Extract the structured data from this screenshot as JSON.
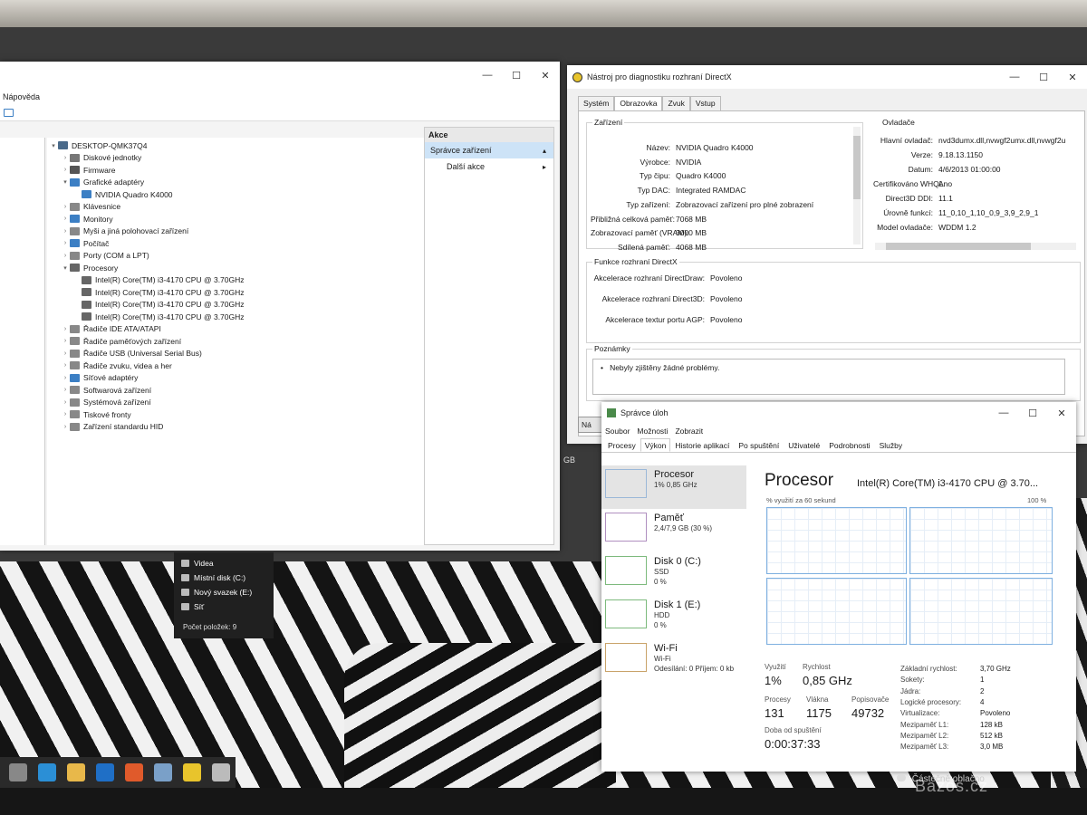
{
  "device_manager": {
    "menu_label": "Nápověda",
    "tree": [
      {
        "label": "DESKTOP-QMK37Q4",
        "depth": 0,
        "arrow": "▾",
        "color": "#4a6a8a"
      },
      {
        "label": "Diskové jednotky",
        "depth": 1,
        "arrow": "›",
        "color": "#777777"
      },
      {
        "label": "Firmware",
        "depth": 1,
        "arrow": "›",
        "color": "#555555"
      },
      {
        "label": "Grafické adaptéry",
        "depth": 1,
        "arrow": "▾",
        "color": "#3c7fc4"
      },
      {
        "label": "NVIDIA Quadro K4000",
        "depth": 2,
        "arrow": "",
        "color": "#3c7fc4"
      },
      {
        "label": "Klávesnice",
        "depth": 1,
        "arrow": "›",
        "color": "#888888"
      },
      {
        "label": "Monitory",
        "depth": 1,
        "arrow": "›",
        "color": "#3c7fc4"
      },
      {
        "label": "Myši a jiná polohovací zařízení",
        "depth": 1,
        "arrow": "›",
        "color": "#888888"
      },
      {
        "label": "Počítač",
        "depth": 1,
        "arrow": "›",
        "color": "#3c7fc4"
      },
      {
        "label": "Porty (COM a LPT)",
        "depth": 1,
        "arrow": "›",
        "color": "#888888"
      },
      {
        "label": "Procesory",
        "depth": 1,
        "arrow": "▾",
        "color": "#666666"
      },
      {
        "label": "Intel(R) Core(TM) i3-4170 CPU @ 3.70GHz",
        "depth": 2,
        "arrow": "",
        "color": "#666666"
      },
      {
        "label": "Intel(R) Core(TM) i3-4170 CPU @ 3.70GHz",
        "depth": 2,
        "arrow": "",
        "color": "#666666"
      },
      {
        "label": "Intel(R) Core(TM) i3-4170 CPU @ 3.70GHz",
        "depth": 2,
        "arrow": "",
        "color": "#666666"
      },
      {
        "label": "Intel(R) Core(TM) i3-4170 CPU @ 3.70GHz",
        "depth": 2,
        "arrow": "",
        "color": "#666666"
      },
      {
        "label": "Řadiče IDE ATA/ATAPI",
        "depth": 1,
        "arrow": "›",
        "color": "#888888"
      },
      {
        "label": "Řadiče paměťových zařízení",
        "depth": 1,
        "arrow": "›",
        "color": "#888888"
      },
      {
        "label": "Řadiče USB (Universal Serial Bus)",
        "depth": 1,
        "arrow": "›",
        "color": "#888888"
      },
      {
        "label": "Řadiče zvuku, videa a her",
        "depth": 1,
        "arrow": "›",
        "color": "#888888"
      },
      {
        "label": "Síťové adaptéry",
        "depth": 1,
        "arrow": "›",
        "color": "#3c7fc4"
      },
      {
        "label": "Softwarová zařízení",
        "depth": 1,
        "arrow": "›",
        "color": "#888888"
      },
      {
        "label": "Systémová zařízení",
        "depth": 1,
        "arrow": "›",
        "color": "#888888"
      },
      {
        "label": "Tiskové fronty",
        "depth": 1,
        "arrow": "›",
        "color": "#888888"
      },
      {
        "label": "Zařízení standardu HID",
        "depth": 1,
        "arrow": "›",
        "color": "#888888"
      }
    ],
    "actions_header": "Akce",
    "actions": [
      {
        "label": "Správce zařízení",
        "selected": true,
        "chevron": "▴"
      },
      {
        "label": "Další akce",
        "selected": false,
        "chevron": "▸"
      }
    ]
  },
  "dxdiag": {
    "title": "Nástroj pro diagnostiku rozhraní DirectX",
    "tabs": [
      "Systém",
      "Obrazovka",
      "Zvuk",
      "Vstup"
    ],
    "active_tab": 1,
    "device_group": "Zařízení",
    "device_rows": [
      {
        "k": "Název:",
        "v": "NVIDIA Quadro K4000"
      },
      {
        "k": "Výrobce:",
        "v": "NVIDIA"
      },
      {
        "k": "Typ čipu:",
        "v": "Quadro K4000"
      },
      {
        "k": "Typ DAC:",
        "v": "Integrated RAMDAC"
      },
      {
        "k": "Typ zařízení:",
        "v": "Zobrazovací zařízení pro plné zobrazení"
      },
      {
        "k": "Přibližná celková paměť:",
        "v": "7068 MB"
      },
      {
        "k": "Zobrazovací paměť (VRAM):",
        "v": "3000 MB"
      },
      {
        "k": "Sdílená paměť:",
        "v": "4068 MB"
      }
    ],
    "driver_group": "Ovladače",
    "driver_rows": [
      {
        "k": "Hlavní ovladač:",
        "v": "nvd3dumx.dll,nvwgf2umx.dll,nvwgf2u"
      },
      {
        "k": "Verze:",
        "v": "9.18.13.1150"
      },
      {
        "k": "Datum:",
        "v": "4/6/2013 01:00:00"
      },
      {
        "k": "Certifikováno WHQL:",
        "v": "Ano"
      },
      {
        "k": "Direct3D DDI:",
        "v": "11.1"
      },
      {
        "k": "Úrovně funkcí:",
        "v": "11_0,10_1,10_0,9_3,9_2,9_1"
      },
      {
        "k": "Model ovladače:",
        "v": "WDDM 1.2"
      }
    ],
    "features_group": "Funkce rozhraní DirectX",
    "features": [
      {
        "k": "Akcelerace rozhraní DirectDraw:",
        "v": "Povoleno"
      },
      {
        "k": "Akcelerace rozhraní Direct3D:",
        "v": "Povoleno"
      },
      {
        "k": "Akcelerace textur portu AGP:",
        "v": "Povoleno"
      }
    ],
    "notes_group": "Poznámky",
    "notes": "Nebyly zjištěny žádné problémy.",
    "bottom_btn_stub": "Ná",
    "gb_stub": "GB"
  },
  "explorer": {
    "items": [
      "Videa",
      "Místní disk (C:)",
      "Nový svazek (E:)",
      "Síť"
    ],
    "status": "Počet položek: 9"
  },
  "task_manager": {
    "title": "Správce úloh",
    "menu": [
      "Soubor",
      "Možnosti",
      "Zobrazit"
    ],
    "tabs": [
      "Procesy",
      "Výkon",
      "Historie aplikací",
      "Po spuštění",
      "Uživatelé",
      "Podrobnosti",
      "Služby"
    ],
    "active_tab": 1,
    "resources": [
      {
        "name": "Procesor",
        "line1": "1% 0,85 GHz",
        "line2": "",
        "selected": true,
        "color": "#9bb8d8"
      },
      {
        "name": "Paměť",
        "line1": "2,4/7,9 GB (30 %)",
        "line2": "",
        "selected": false,
        "color": "#b08fc0"
      },
      {
        "name": "Disk 0 (C:)",
        "line1": "SSD",
        "line2": "0 %",
        "selected": false,
        "color": "#7dba7d"
      },
      {
        "name": "Disk 1 (E:)",
        "line1": "HDD",
        "line2": "0 %",
        "selected": false,
        "color": "#7dba7d"
      },
      {
        "name": "Wi-Fi",
        "line1": "Wi-Fi",
        "line2": "Odesílání: 0 Příjem: 0 kb",
        "selected": false,
        "color": "#c9a36a"
      }
    ],
    "heading": "Procesor",
    "model": "Intel(R) Core(TM) i3-4170 CPU @ 3.70...",
    "graph_label": "% využití za 60 sekund",
    "graph_max": "100 %",
    "stats": {
      "util_label": "Využití",
      "util_value": "1%",
      "speed_label": "Rychlost",
      "speed_value": "0,85 GHz",
      "proc_label": "Procesy",
      "proc_value": "131",
      "threads_label": "Vlákna",
      "threads_value": "1175",
      "handles_label": "Popisovače",
      "handles_value": "49732",
      "uptime_label": "Doba od spuštění",
      "uptime_value": "0:00:37:33"
    },
    "specs": [
      {
        "k": "Základní rychlost:",
        "v": "3,70 GHz"
      },
      {
        "k": "Sokety:",
        "v": "1"
      },
      {
        "k": "Jádra:",
        "v": "2"
      },
      {
        "k": "Logické procesory:",
        "v": "4"
      },
      {
        "k": "Virtualizace:",
        "v": "Povoleno"
      },
      {
        "k": "Mezipaměť L1:",
        "v": "128 kB"
      },
      {
        "k": "Mezipaměť L2:",
        "v": "512 kB"
      },
      {
        "k": "Mezipaměť L3:",
        "v": "3,0 MB"
      }
    ]
  },
  "taskbar": {
    "icons": [
      "task-view-icon",
      "edge-icon",
      "file-explorer-icon",
      "outlook-icon",
      "brave-icon",
      "device-manager-icon",
      "dxdiag-icon",
      "app-icon"
    ],
    "tray_text": "Částečně oblačno"
  },
  "watermark": "Bazos.cz"
}
